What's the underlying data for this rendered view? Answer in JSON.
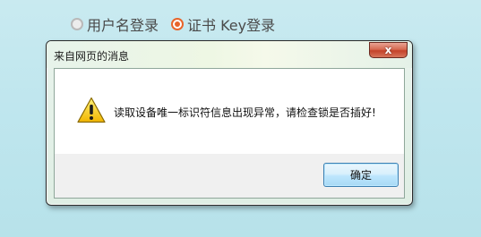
{
  "login_options": {
    "username_login": "用户名登录",
    "cert_key_login": "证书 Key登录",
    "selected": "cert_key_login"
  },
  "dialog": {
    "title": "来自网页的消息",
    "close_glyph": "x",
    "message": "读取设备唯一标识符信息出现异常，请检查锁是否插好!",
    "ok_label": "确定",
    "icon": "warning-icon"
  },
  "colors": {
    "radio_accent": "#e8642a",
    "close_button": "#c4432a",
    "ok_button_border": "#3c7fb1",
    "background": "#c9eaf0"
  }
}
